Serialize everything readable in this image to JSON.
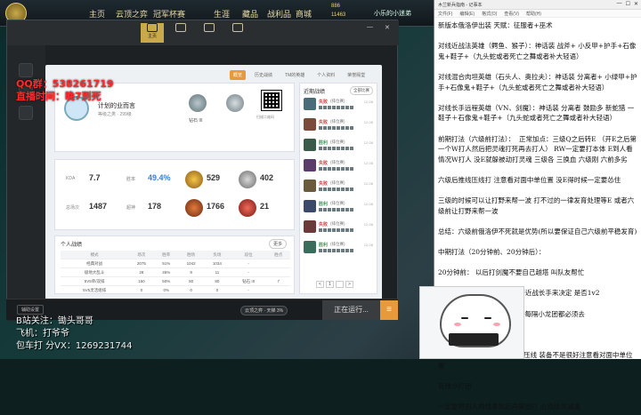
{
  "topbar": {
    "nav": [
      "主页",
      "云顶之弈",
      "冠军杯赛",
      "生涯",
      "藏品",
      "战利品",
      "商城"
    ],
    "rp": "886",
    "be": "11463",
    "user": "小乐的小迷弟"
  },
  "client": {
    "tabs": [
      "主页",
      "",
      "",
      ""
    ],
    "profile_tabs": [
      "游戏",
      "概览",
      "历史战绩",
      "TM的英雄",
      "个人资料",
      "荣誉殿堂"
    ],
    "profile_name": "计划的业而言",
    "profile_sub": "等级之类 · 299级",
    "rank1": "钻石 III",
    "rank2": "",
    "qr_label": "扫描二维码",
    "stats": {
      "kda_label": "KDA",
      "kda": "7.7",
      "win_label": "胜率",
      "win": "49.4%",
      "mvp_label": "MVP",
      "mvp": "529",
      "x_label": "",
      "x": "402",
      "games_label": "总场次",
      "games": "1487",
      "y_label": "超神",
      "y": "178",
      "z": "1766",
      "w": "21"
    },
    "personal": {
      "title": "个人战绩",
      "btn": "更多",
      "headers": [
        "模式",
        "场次",
        "胜率",
        "胜场",
        "负场",
        "段位",
        "胜点"
      ],
      "rows": [
        [
          "经典对战",
          "2075",
          "51%",
          "1042",
          "1034",
          "-",
          ""
        ],
        [
          "极地大乱斗",
          "28",
          "45%",
          "9",
          "11",
          "-",
          ""
        ],
        [
          "5V5单/双排",
          "150",
          "50%",
          "80",
          "80",
          "钻石 III",
          "7"
        ],
        [
          "5V5灵活组排",
          "0",
          "0%",
          "0",
          "0",
          "-",
          ""
        ]
      ]
    },
    "recent": {
      "title": "近期战绩",
      "select": "全部比赛",
      "items": [
        {
          "res": "失败",
          "mode": "(排位赛)",
          "date": "12-08",
          "color": "#4a6b7a"
        },
        {
          "res": "失败",
          "mode": "(排位赛)",
          "date": "12-08",
          "color": "#7a4a3b"
        },
        {
          "res": "胜利",
          "mode": "(排位赛)",
          "date": "12-08",
          "color": "#3b5a4a"
        },
        {
          "res": "失败",
          "mode": "(排位赛)",
          "date": "12-08",
          "color": "#5a3b6b"
        },
        {
          "res": "失败",
          "mode": "(排位赛)",
          "date": "12-08",
          "color": "#6b5a3b"
        },
        {
          "res": "胜利",
          "mode": "(排位赛)",
          "date": "12-08",
          "color": "#3b4a6b"
        },
        {
          "res": "失败",
          "mode": "(排位赛)",
          "date": "12-08",
          "color": "#6b3b3b"
        },
        {
          "res": "胜利",
          "mode": "(排位赛)",
          "date": "12-08",
          "color": "#3b6b5a"
        }
      ],
      "pager": [
        "<",
        "1",
        "",
        ">"
      ]
    },
    "bottom": {
      "assist": "辅助设置",
      "mode": "云顶之弈 · 天梯 3%",
      "running": "正在运行...",
      "menu": "≡"
    }
  },
  "overlay": {
    "qq_label": "QQ群：",
    "qq": "538261719",
    "live_time_label": "直播时间：",
    "live_time": "晚7到死",
    "bili": "B站关注：锄头哥哥",
    "fc": "飞机：打爷爷",
    "pack": "包车打 分VX：1269231744"
  },
  "notepad": {
    "title": "木兰新兵指南 - 记事本",
    "menu": [
      "文件(F)",
      "编辑(E)",
      "格式(O)",
      "查看(V)",
      "帮助(H)"
    ],
    "text": "新版本俄洛伊出装 天赋：征服者+巫术\n\n对线近战法英雄（鳄鱼、猴子）：神话装 战斧+ 小反甲+护手+石像鬼+鞋子+（九头蛇或者死亡之舞或者补大轻语）\n\n对线混合肉坦英雄（石头人、奥拉夫）：神话装 分离者+ 小绿甲+护手+石像鬼+鞋子+（九头蛇或者死亡之舞或者补大轻语）\n\n对线长手远程英雄（VN、剑魔）：神话装 分离者 鼓励多 新蛇猎 一鞋子＋石像鬼+鞋子+（九头蛇或者死亡之舞或者补大轻语）\n\n前期打法（六级前打法）：  正常加点：三级Q之后转E （开E之后第一个W打人然后把灵魂打死再去打人） RW一定要打本体 E到人看情况W打人 没E就躲被动打灵魂 三级各 三换血 六级刚 六前多劣\n\n六级后推线压线打 注意看对面中单位置 没E得时候一定要怂住\n\n三级的时候可以让打野来帮一波 打不过的一律发育处理等E 或者六级前让打野来帮一波\n\n总结：六级前俄洛伊不死就是优势(所以要保证自己六级前平稳发育)\n\n中期打法（20分钟前、20分钟后）：\n\n20分钟前： 以后打剑魔不要自己越塔 叫队友帮忙\n\n如果E之后 根据对面打野是否近战长手来决定 是否1v2\n\n注意留TP 注意小龙时间 注意每隔小龙团都必须去\n\n小龙团是节奏点\n\n切记：没R时候多劣 有R在去压线 装备不是很好注意看对面中单位置\n\n有线少打团\n\n一定要将别人的线拿到后再集团打 必须给到减速"
  }
}
